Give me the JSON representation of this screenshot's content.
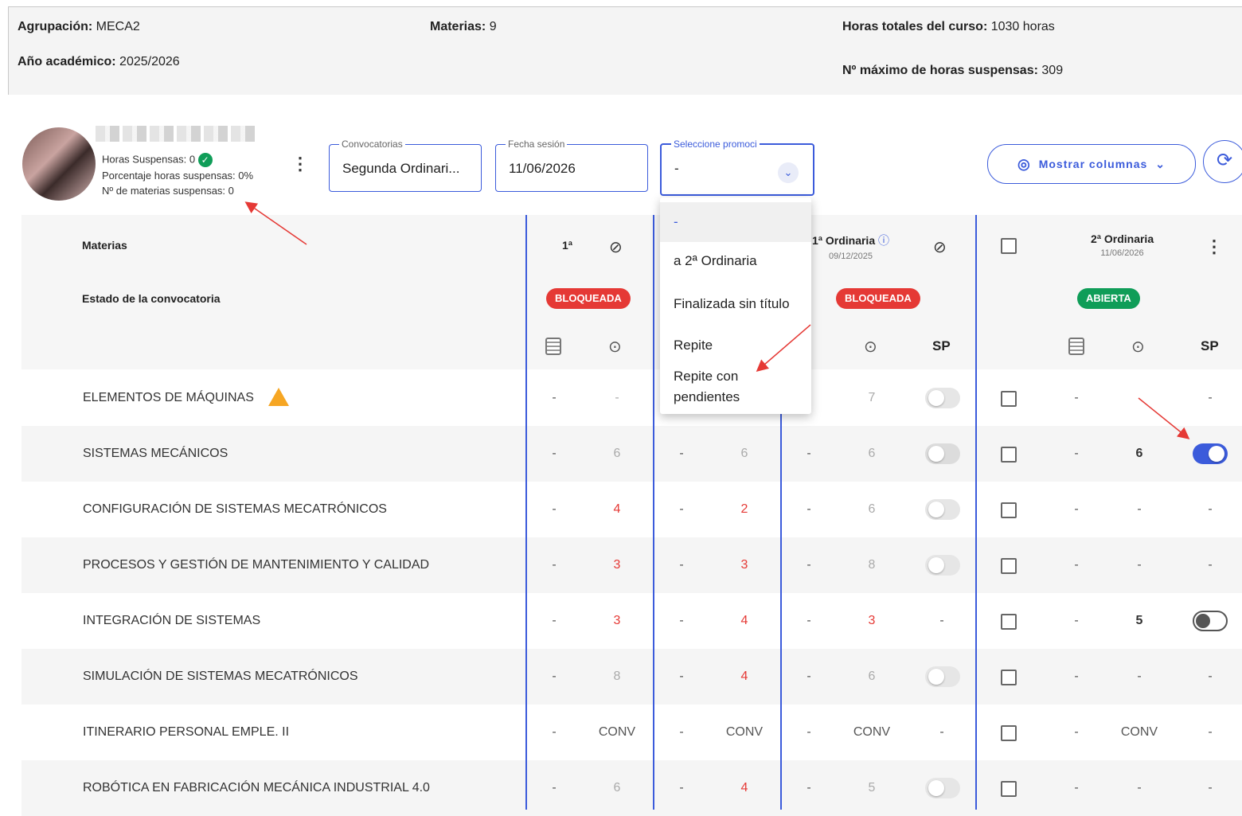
{
  "header": {
    "agrupacion_label": "Agrupación:",
    "agrupacion_value": "MECA2",
    "anio_label": "Año académico:",
    "anio_value": "2025/2026",
    "materias_label": "Materias:",
    "materias_value": "9",
    "horas_label": "Horas totales del curso:",
    "horas_value": "1030 horas",
    "max_label": "Nº máximo de horas suspensas:",
    "max_value": "309"
  },
  "student": {
    "horas_suspensas": "Horas Suspensas: 0",
    "porcentaje": "Porcentaje horas suspensas:  0%",
    "materias_suspensas": "Nº de materias suspensas:  0"
  },
  "filters": {
    "convocatorias_label": "Convocatorias",
    "convocatorias_value": "Segunda Ordinari...",
    "fecha_label": "Fecha sesión",
    "fecha_value": "11/06/2026",
    "promoci_label": "Seleccione promoci",
    "promoci_value": "-"
  },
  "buttons": {
    "mostrar_columnas": "Mostrar columnas"
  },
  "dropdown": {
    "items": [
      "-",
      "a 2ª Ordinaria",
      "Finalizada sin título",
      "Repite",
      "Repite con",
      "pendientes"
    ]
  },
  "table": {
    "col_materias": "Materias",
    "col_estado": "Estado de la convocatoria",
    "conv1_title": "1ª",
    "conv3_title": "1ª Ordinaria",
    "conv3_date": "09/12/2025",
    "conv4_title": "2ª Ordinaria",
    "conv4_date": "11/06/2026",
    "badge_bloqueada": "BLOQUEADA",
    "badge_abierta": "ABIERTA",
    "sp": "SP",
    "rows": [
      {
        "name": "ELEMENTOS DE MÁQUINAS",
        "c": [
          "-",
          "-",
          "",
          "",
          "",
          "7"
        ],
        "d": [
          "-",
          "",
          "-"
        ]
      },
      {
        "name": "SISTEMAS MECÁNICOS",
        "c": [
          "-",
          "6",
          "-",
          "6",
          "-",
          "6"
        ],
        "d": [
          "-",
          "6",
          ""
        ]
      },
      {
        "name": "CONFIGURACIÓN DE SISTEMAS MECATRÓNICOS",
        "c": [
          "-",
          "4",
          "-",
          "2",
          "-",
          "6"
        ],
        "d": [
          "-",
          "-",
          "-"
        ]
      },
      {
        "name": "PROCESOS Y GESTIÓN DE MANTENIMIENTO Y CALIDAD",
        "c": [
          "-",
          "3",
          "-",
          "3",
          "-",
          "8"
        ],
        "d": [
          "-",
          "-",
          "-"
        ]
      },
      {
        "name": "INTEGRACIÓN DE SISTEMAS",
        "c": [
          "-",
          "3",
          "-",
          "4",
          "-",
          "3"
        ],
        "d": [
          "-",
          "5",
          ""
        ]
      },
      {
        "name": "SIMULACIÓN DE SISTEMAS MECATRÓNICOS",
        "c": [
          "-",
          "8",
          "-",
          "4",
          "-",
          "6"
        ],
        "d": [
          "-",
          "-",
          "-"
        ]
      },
      {
        "name": "ITINERARIO PERSONAL EMPLE. II",
        "c": [
          "-",
          "CONV",
          "-",
          "CONV",
          "-",
          "CONV"
        ],
        "d": [
          "-",
          "CONV",
          "-"
        ]
      },
      {
        "name": "ROBÓTICA EN FABRICACIÓN MECÁNICA INDUSTRIAL 4.0",
        "c": [
          "-",
          "6",
          "-",
          "4",
          "-",
          "5"
        ],
        "d": [
          "-",
          "-",
          "-"
        ]
      }
    ],
    "sp3_dash": "-"
  },
  "colors": {
    "accent": "#3b5bdb",
    "red": "#e53935",
    "green": "#0f9d58"
  }
}
